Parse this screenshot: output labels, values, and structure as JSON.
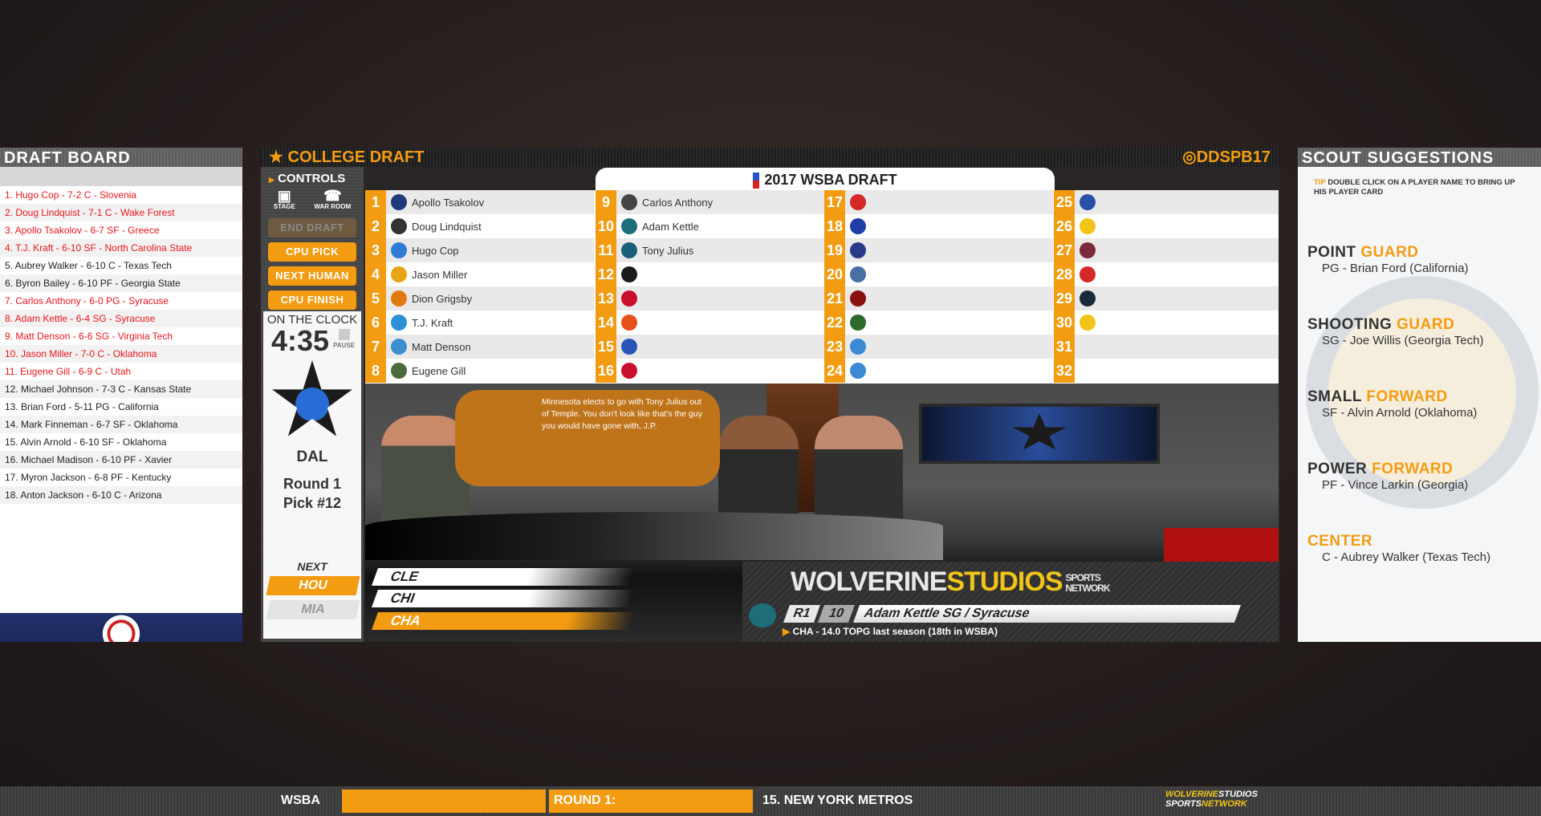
{
  "draft_board": {
    "title": "DRAFT BOARD",
    "rows": [
      {
        "text": "1. Hugo Cop - 7-2 C - Slovenia",
        "taken": true
      },
      {
        "text": "2. Doug Lindquist - 7-1 C - Wake Forest",
        "taken": true
      },
      {
        "text": "3. Apollo  Tsakolov - 6-7 SF - Greece",
        "taken": true
      },
      {
        "text": "4. T.J. Kraft - 6-10 SF - North Carolina State",
        "taken": true
      },
      {
        "text": "5. Aubrey Walker - 6-10 C - Texas Tech",
        "taken": false
      },
      {
        "text": "6. Byron Bailey - 6-10 PF - Georgia State",
        "taken": false
      },
      {
        "text": "7. Carlos Anthony - 6-0 PG - Syracuse",
        "taken": true
      },
      {
        "text": "8. Adam Kettle - 6-4 SG - Syracuse",
        "taken": true
      },
      {
        "text": "9. Matt Denson - 6-6 SG - Virginia Tech",
        "taken": true
      },
      {
        "text": "10. Jason Miller - 7-0 C - Oklahoma",
        "taken": true
      },
      {
        "text": "11. Eugene Gill - 6-9 C - Utah",
        "taken": true
      },
      {
        "text": "12. Michael Johnson - 7-3 C - Kansas State",
        "taken": false
      },
      {
        "text": "13. Brian Ford - 5-11 PG - California",
        "taken": false
      },
      {
        "text": "14. Mark Finneman - 6-7 SF - Oklahoma",
        "taken": false
      },
      {
        "text": "15. Alvin Arnold - 6-10 SF - Oklahoma",
        "taken": false
      },
      {
        "text": "16. Michael Madison - 6-10 PF - Xavier",
        "taken": false
      },
      {
        "text": "17. Myron Jackson - 6-8 PF - Kentucky",
        "taken": false
      },
      {
        "text": "18. Anton Jackson - 6-10 C - Arizona",
        "taken": false
      }
    ]
  },
  "header": {
    "title": "COLLEGE DRAFT",
    "brand": "DDSPB17"
  },
  "controls": {
    "title": "CONTROLS",
    "stage": "STAGE",
    "war_room": "WAR ROOM",
    "end_draft": "END DRAFT",
    "cpu_pick": "CPU PICK",
    "next_human": "NEXT HUMAN",
    "cpu_finish": "CPU FINISH"
  },
  "clock": {
    "label": "ON THE CLOCK",
    "time": "4:35",
    "pause": "PAUSE",
    "team": "DAL",
    "round": "Round 1",
    "pick": "Pick #12",
    "next_label": "NEXT",
    "next": [
      "HOU",
      "MIA"
    ]
  },
  "draft": {
    "title": "2017 WSBA DRAFT",
    "picks": [
      {
        "n": "1",
        "player": "Apollo  Tsakolov",
        "color": "#1f3a7a"
      },
      {
        "n": "2",
        "player": "Doug Lindquist",
        "color": "#333"
      },
      {
        "n": "3",
        "player": "Hugo Cop",
        "color": "#2f7bd6"
      },
      {
        "n": "4",
        "player": "Jason Miller",
        "color": "#e8a317"
      },
      {
        "n": "5",
        "player": "Dion Grigsby",
        "color": "#e07a10"
      },
      {
        "n": "6",
        "player": "T.J. Kraft",
        "color": "#2d8fd6"
      },
      {
        "n": "7",
        "player": "Matt Denson",
        "color": "#3d8ed0"
      },
      {
        "n": "8",
        "player": "Eugene Gill",
        "color": "#4a6b3a"
      },
      {
        "n": "9",
        "player": "Carlos Anthony",
        "color": "#444"
      },
      {
        "n": "10",
        "player": "Adam Kettle",
        "color": "#1e6e7a"
      },
      {
        "n": "11",
        "player": "Tony Julius",
        "color": "#1b5e7a"
      },
      {
        "n": "12",
        "player": "",
        "color": "#1b1b1b"
      },
      {
        "n": "13",
        "player": "",
        "color": "#c8102e"
      },
      {
        "n": "14",
        "player": "",
        "color": "#e8501a"
      },
      {
        "n": "15",
        "player": "",
        "color": "#2a54b8"
      },
      {
        "n": "16",
        "player": "",
        "color": "#c8102e"
      },
      {
        "n": "17",
        "player": "",
        "color": "#d62828"
      },
      {
        "n": "18",
        "player": "",
        "color": "#1f3fa8"
      },
      {
        "n": "19",
        "player": "",
        "color": "#2a3a8a"
      },
      {
        "n": "20",
        "player": "",
        "color": "#4a6fa5"
      },
      {
        "n": "21",
        "player": "",
        "color": "#8a1010"
      },
      {
        "n": "22",
        "player": "",
        "color": "#2a6a2a"
      },
      {
        "n": "23",
        "player": "",
        "color": "#3a8ad6"
      },
      {
        "n": "24",
        "player": "",
        "color": "#3a8ad6"
      },
      {
        "n": "25",
        "player": "",
        "color": "#2a4fa8"
      },
      {
        "n": "26",
        "player": "",
        "color": "#f0c419"
      },
      {
        "n": "27",
        "player": "",
        "color": "#7a2a3a"
      },
      {
        "n": "28",
        "player": "",
        "color": "#d62828"
      },
      {
        "n": "29",
        "player": "",
        "color": "#1b2a3a"
      },
      {
        "n": "30",
        "player": "",
        "color": "#f0c419"
      },
      {
        "n": "31",
        "player": "",
        "color": ""
      },
      {
        "n": "32",
        "player": "",
        "color": ""
      }
    ]
  },
  "stage": {
    "commentary": "Minnesota elects to go with Tony Julius out of Temple. You don't look like that's the guy you would have gone with, J.P.",
    "teams": [
      "CLE",
      "CHI",
      "CHA"
    ],
    "network_a": "WOLVERINE",
    "network_b": "STUDIOS",
    "network_c": "SPORTS",
    "network_d": "NETWORK",
    "round": "R1",
    "pick": "10",
    "selection": "Adam Kettle SG / Syracuse",
    "stat": "CHA - 14.0 TOPG last season (18th in WSBA)"
  },
  "scout": {
    "title": "SCOUT SUGGESTIONS",
    "tip_label": "TIP",
    "tip": "DOUBLE CLICK ON A PLAYER NAME TO BRING UP HIS PLAYER CARD",
    "positions": [
      {
        "a": "POINT",
        "b": "GUARD",
        "player": "PG - Brian Ford (California)"
      },
      {
        "a": "SHOOTING",
        "b": "GUARD",
        "player": "SG - Joe Willis (Georgia Tech)"
      },
      {
        "a": "SMALL",
        "b": "FORWARD",
        "player": "SF - Alvin Arnold (Oklahoma)"
      },
      {
        "a": "POWER",
        "b": "FORWARD",
        "player": "PF - Vince Larkin (Georgia)"
      },
      {
        "a": "",
        "b": "CENTER",
        "player": "C - Aubrey Walker (Texas Tech)"
      }
    ]
  },
  "bottom": {
    "league": "WSBA",
    "round": "ROUND 1:",
    "team": "15. NEW YORK METROS",
    "logo_a": "WOLVERINE",
    "logo_b": "STUDIOS",
    "logo_c": "SPORTS",
    "logo_d": "NETWORK"
  },
  "colors": {
    "accent": "#f39c12",
    "taken": "#e8161e"
  }
}
